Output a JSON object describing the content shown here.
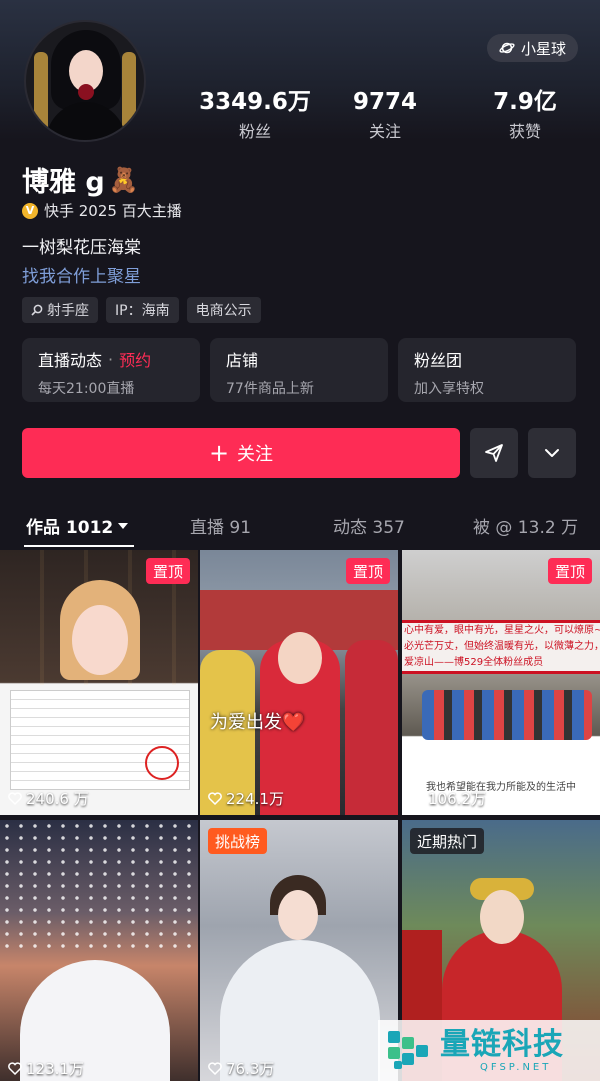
{
  "header": {
    "planet_label": "小星球"
  },
  "stats": [
    {
      "value": "3349.6万",
      "label": "粉丝"
    },
    {
      "value": "9774",
      "label": "关注"
    },
    {
      "value": "7.9亿",
      "label": "获赞"
    }
  ],
  "profile": {
    "name": "博雅 g",
    "name_emoji": "🧸",
    "verified_text": "快手 2025 百大主播",
    "verified_badge": "V",
    "bio": "一树梨花压海棠",
    "link_text": "找我合作上聚星"
  },
  "tags": [
    "射手座",
    "IP：海南",
    "电商公示"
  ],
  "cards": [
    {
      "title": "直播动态",
      "dot": "·",
      "highlight": "预约",
      "subtitle": "每天21:00直播"
    },
    {
      "title": "店铺",
      "subtitle": "77件商品上新"
    },
    {
      "title": "粉丝团",
      "subtitle": "加入享特权"
    }
  ],
  "actions": {
    "follow_plus": "+",
    "follow_label": "关注"
  },
  "tabs": [
    {
      "label": "作品 1012"
    },
    {
      "label": "直播 91"
    },
    {
      "label": "动态 357"
    },
    {
      "label": "被 @ 13.2 万"
    }
  ],
  "videos": [
    {
      "badge": "置顶",
      "likes": "240.6 万"
    },
    {
      "badge": "置顶",
      "likes": "224.1万",
      "caption": "为爱出发❤️"
    },
    {
      "badge": "置顶",
      "likes": "106.2万",
      "banner_line1": "心中有爱，眼中有光，星星之火，可以燎原~",
      "banner_line2": "必光芒万丈，但始终温暖有光，以微薄之力，",
      "banner_line3": "爱凉山——博529全体粉丝成员",
      "subcaption": "我也希望能在我力所能及的生活中"
    },
    {
      "likes": "123.1万"
    },
    {
      "badge": "挑战榜",
      "likes": "76.3万"
    },
    {
      "badge": "近期热门",
      "likes": ""
    }
  ],
  "watermark": {
    "title": "量链科技",
    "sub": "QFSP.NET"
  },
  "colors": {
    "accent": "#fe2c55",
    "background": "#16151d",
    "link": "#7f9ed8",
    "verified": "#f2b52b"
  },
  "icons": [
    "planet-icon",
    "verified-badge-icon",
    "search-icon",
    "plus-icon",
    "share-icon",
    "chevron-down-icon",
    "heart-icon"
  ]
}
